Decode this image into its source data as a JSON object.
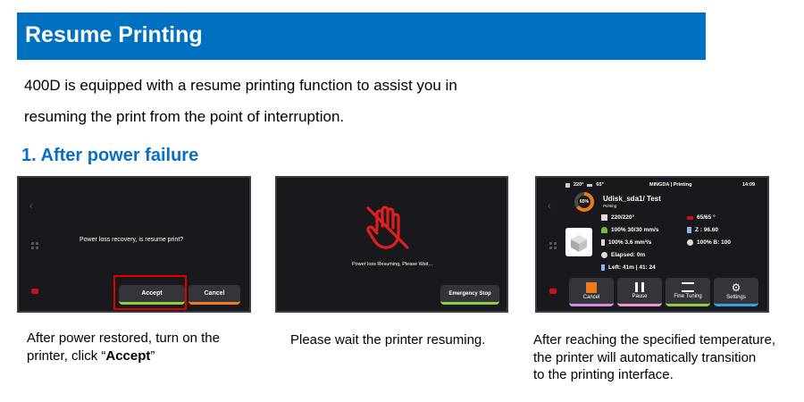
{
  "header": {
    "title": "Resume Printing"
  },
  "intro": {
    "line1": "400D is equipped with a resume printing function to assist you in",
    "line2": "resuming the print from the point of interruption."
  },
  "section": {
    "title": "1. After power failure"
  },
  "screen1": {
    "message": "Power loss recovery, is resume print?",
    "accept_label": "Accept",
    "cancel_label": "Cancel"
  },
  "screen2": {
    "message": "Power loss Resuming, Please Wait...",
    "emergency_label": "Emergency Stop"
  },
  "screen3": {
    "status": {
      "nozzle_temp": "220°",
      "bed_temp": "65°",
      "title": "MINGDA | Printing",
      "time": "14:09"
    },
    "progress": "65%",
    "file_name": "Udisk_sda1/ Test",
    "file_state": "Printing",
    "nozzle": "220/220°",
    "bed": "65/65 °",
    "speed": "100% 30/30 mm/s",
    "z": "Z : 96.60",
    "flow": "100%   3.6 mm³/s",
    "fan": "100% B: 100",
    "elapsed": "Elapsed: 0m",
    "left": "Left:  41m | 41: 24",
    "buttons": {
      "cancel": "Cancel",
      "pause": "Pause",
      "fine_tuning": "Fine Tuning",
      "settings": "Settings"
    }
  },
  "captions": {
    "c1_line1": "After power restored, turn on the",
    "c1_line2_pre": "printer, click “",
    "c1_line2_bold": "Accept",
    "c1_line2_post": "”",
    "c2": "Please wait the printer resuming.",
    "c3_line1": "After reaching the specified temperature,",
    "c3_line2": "the printer will automatically transition",
    "c3_line3": "to the printing interface."
  },
  "colors": {
    "banner": "#0070c0",
    "section": "#0a6fc4",
    "highlight": "#e00000",
    "accept_underline": "#8fcc3b",
    "cancel_underline": "#f07a1a",
    "progress_ring": "#f07a1a",
    "hand_icon": "#e0201c"
  }
}
